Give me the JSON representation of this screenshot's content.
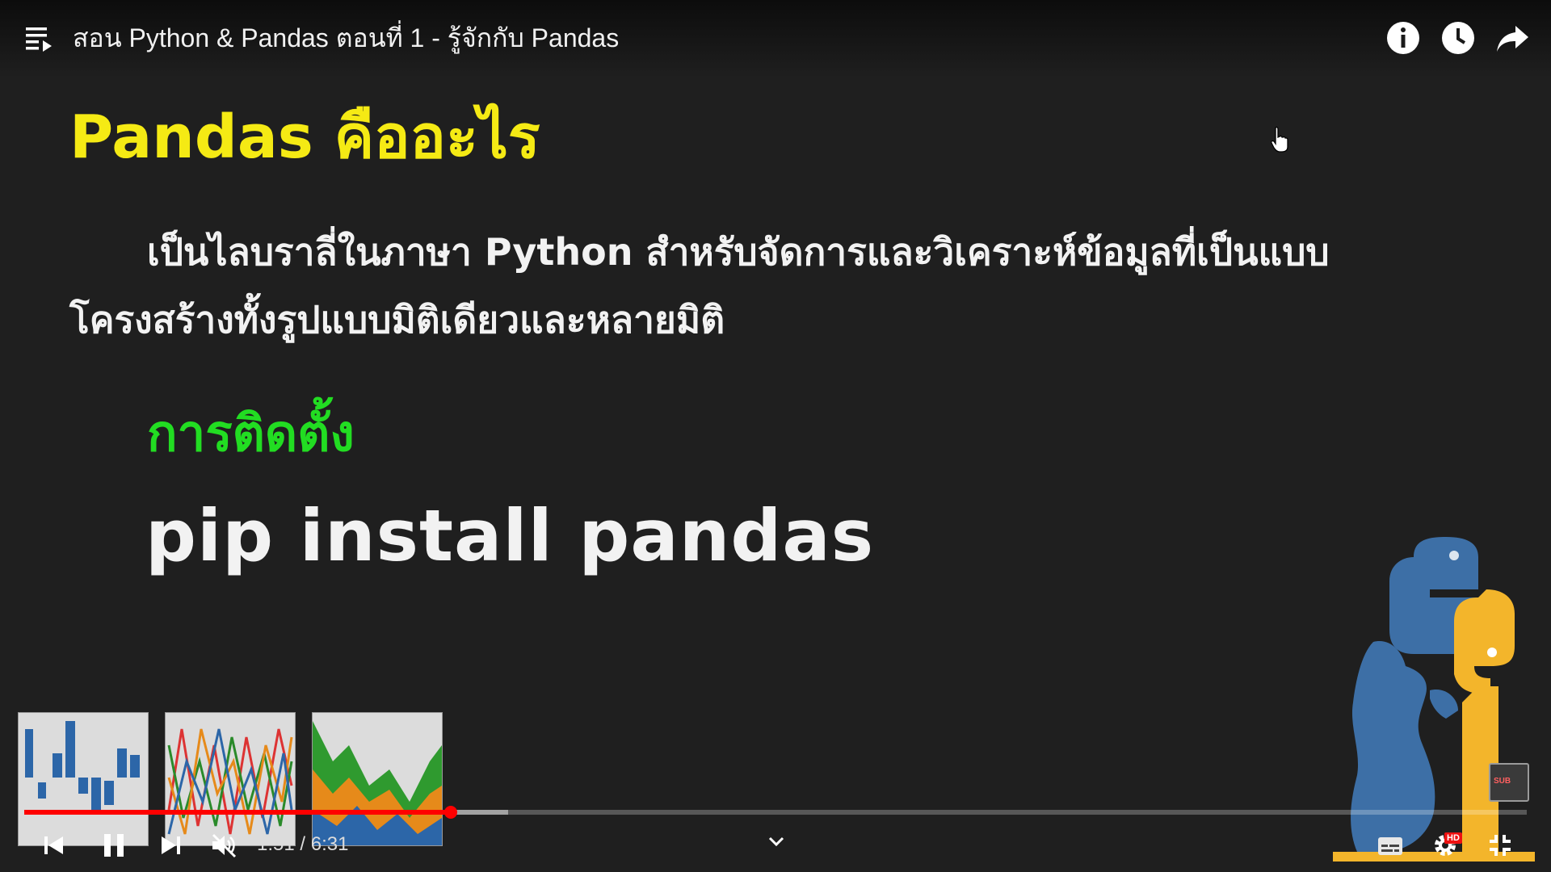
{
  "player": {
    "title": "สอน Python & Pandas ตอนที่ 1 - รู้จักกับ Pandas",
    "time_current": "1:51",
    "time_separator": " / ",
    "time_total": "6:31",
    "progress_played_fraction": 0.284,
    "progress_buffered_fraction": 0.322,
    "muted": true,
    "quality_badge": "HD",
    "accent_color": "#ff0000"
  },
  "slide": {
    "heading": "Pandas คืออะไร",
    "description": "เป็นไลบราลี่ในภาษา Python สำหรับจัดการและวิเคราะห์ข้อมูลที่เป็นแบบโครงสร้างทั้งรูปแบบมิติเดียวและหลายมิติ",
    "install_heading": "การติดตั้ง",
    "install_command": "pip install pandas",
    "heading_color": "#f5ea14",
    "install_heading_color": "#22dd22"
  },
  "overlay": {
    "sub_badge": "SUB"
  },
  "icons": {
    "playlist": "playlist-icon",
    "info": "info-icon",
    "watch_later": "clock-icon",
    "share": "share-icon",
    "previous": "skip-previous-icon",
    "pause": "pause-icon",
    "next": "skip-next-icon",
    "volume": "volume-muted-icon",
    "chevron": "chevron-down-icon",
    "subtitles": "subtitles-icon",
    "settings": "gear-icon",
    "fullscreen_exit": "fullscreen-exit-icon"
  }
}
